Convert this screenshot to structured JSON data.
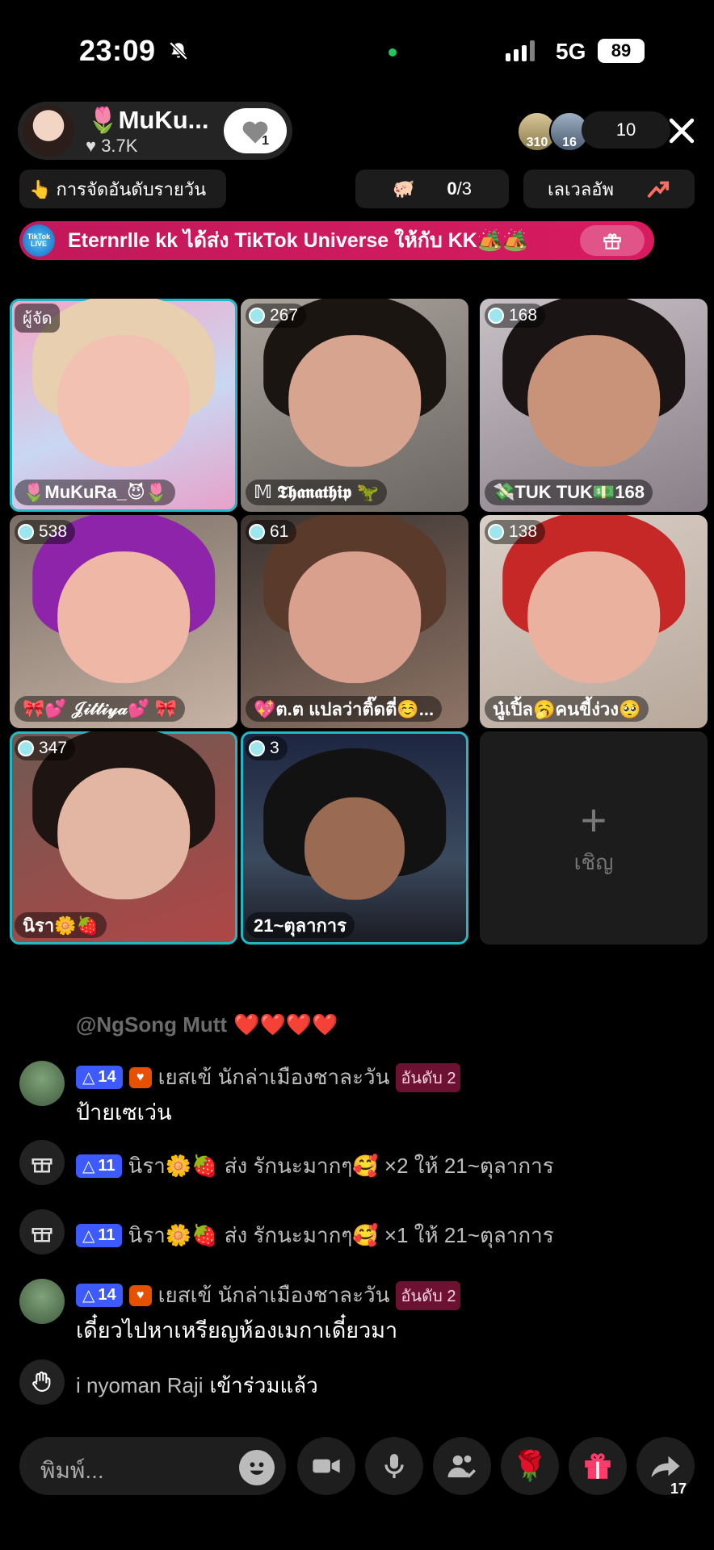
{
  "status_bar": {
    "time": "23:09",
    "network": "5G",
    "battery": "89"
  },
  "host": {
    "name": "🌷MuKu...",
    "likes": "3.7K",
    "follow_count": "1"
  },
  "viewers": {
    "avatar1_badge": "310",
    "avatar2_badge": "16",
    "count": "10"
  },
  "ranking_chip": {
    "label": "👆 การจัดอันดับรายวัน"
  },
  "progress_chip": {
    "current": "0",
    "total": "/3"
  },
  "level_chip": {
    "label": "เลเวลอัพ"
  },
  "gift_banner": {
    "text": "Eternrlle kk ได้ส่ง TikTok Universe ให้กับ KK🏕️🏕️",
    "badge_text": "TikTok LIVE"
  },
  "tiles": [
    {
      "badge": "ผู้จัด",
      "name": "🌷MuKuRa_😈🌷"
    },
    {
      "badge": "267",
      "name": "𝕄 𝕿𝖍𝖆𝖓𝖆𝖙𝖍𝖎𝖕 🦖"
    },
    {
      "badge": "168",
      "name": "💸TUK TUK💵168"
    },
    {
      "badge": "538",
      "name": "🎀💕 𝒥𝒾𝓉𝓉𝒾𝓎𝒶💕 🎀"
    },
    {
      "badge": "61",
      "name": "💖ต.ต แปลว่าติ๊ดตี่☺️..."
    },
    {
      "badge": "138",
      "name": "นู๋เปิ้ล🥱คนขี้ง่วง🥺"
    },
    {
      "badge": "347",
      "name": "นิรา🌼🍓"
    },
    {
      "badge": "3",
      "name": "21~ตุลาการ"
    }
  ],
  "invite": {
    "plus": "+",
    "label": "เชิญ"
  },
  "chat": [
    {
      "user": "@NgSong Mutt",
      "text": "❤️❤️❤️❤️"
    },
    {
      "level": "14",
      "user": "เยสเข้ นักล่าเมืองชาละวัน",
      "rank": "อันดับ 2",
      "text": "ป้ายเซเว่น"
    },
    {
      "level": "11",
      "user": "นิรา🌼🍓",
      "text": "ส่ง รักนะมากๆ🥰 ×2 ให้ 21~ตุลาการ"
    },
    {
      "level": "11",
      "user": "นิรา🌼🍓",
      "text": "ส่ง รักนะมากๆ🥰 ×1 ให้ 21~ตุลาการ"
    },
    {
      "level": "14",
      "user": "เยสเข้ นักล่าเมืองชาละวัน",
      "rank": "อันดับ 2",
      "text": "เดี๋ยวไปหาเหรียญห้องเมกาเดี๋ยวมา"
    },
    {
      "user": "i nyoman Raji",
      "text": "เข้าร่วมแล้ว"
    }
  ],
  "input": {
    "placeholder": "พิมพ์..."
  },
  "share": {
    "count": "17"
  },
  "colors": {
    "accent": "#22b7c4",
    "banner": "#d81b60",
    "level_badge": "#3d5afe"
  }
}
